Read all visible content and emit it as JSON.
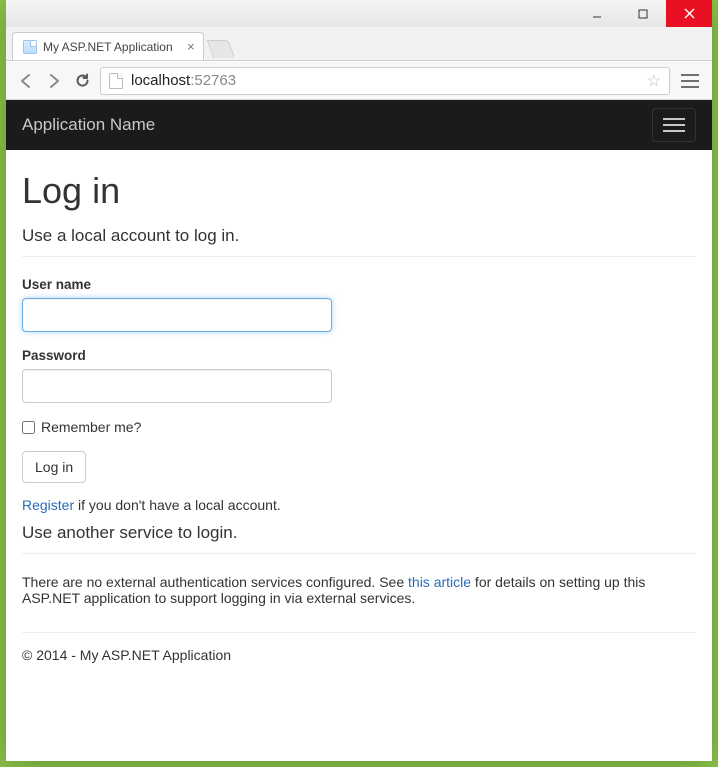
{
  "browser": {
    "tab_title": "My ASP.NET Application",
    "url_host": "localhost",
    "url_port": ":52763"
  },
  "navbar": {
    "brand": "Application Name"
  },
  "page": {
    "heading": "Log in",
    "subheading": "Use a local account to log in.",
    "username_label": "User name",
    "username_value": "",
    "password_label": "Password",
    "password_value": "",
    "remember_label": "Remember me?",
    "remember_checked": false,
    "submit_label": "Log in",
    "register_link": "Register",
    "register_rest": " if you don't have a local account.",
    "other_heading": "Use another service to login.",
    "external_pre": "There are no external authentication services configured. See ",
    "external_link": "this article",
    "external_post": " for details on setting up this ASP.NET application to support logging in via external services."
  },
  "footer": {
    "text": "© 2014 - My ASP.NET Application"
  }
}
